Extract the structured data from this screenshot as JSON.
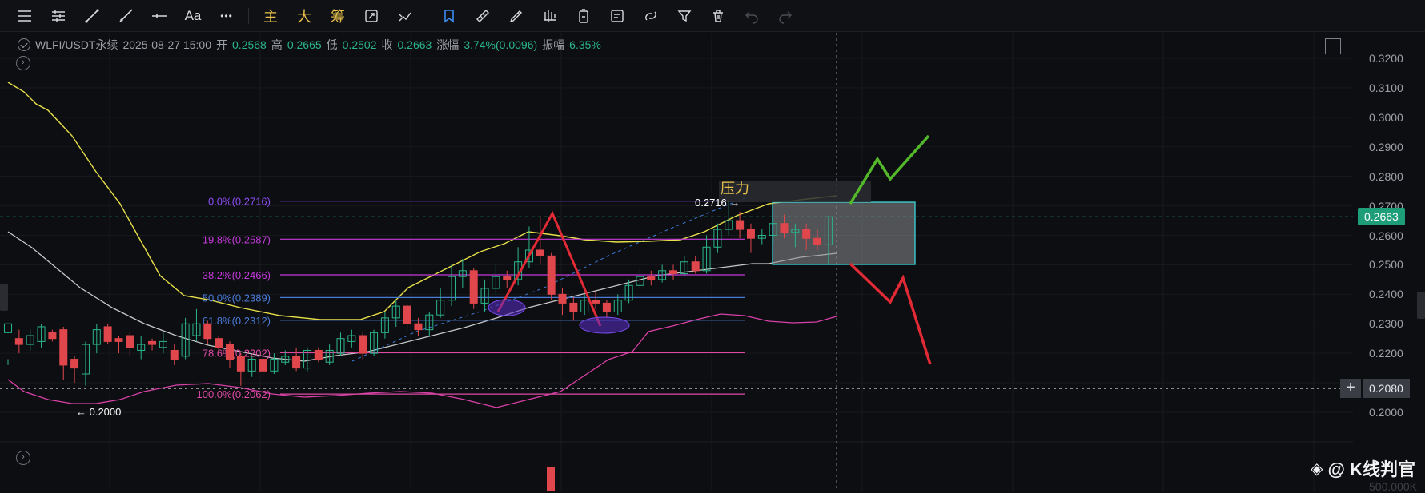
{
  "toolbar": {
    "tools": [
      {
        "name": "menu-lines-icon"
      },
      {
        "name": "horizontal-ray-icon"
      },
      {
        "name": "trend-line-icon"
      },
      {
        "name": "ray-line-icon"
      },
      {
        "name": "horizontal-line-icon"
      }
    ],
    "text_label": "Aa",
    "more_label": "•••",
    "indicators": [
      "主",
      "大",
      "筹"
    ],
    "right_tools": [
      "magnet-icon",
      "ruler-icon",
      "brush-icon",
      "pattern-icon",
      "battery-icon",
      "note-icon",
      "link-icon",
      "filter-icon",
      "trash-icon",
      "undo-icon",
      "redo-icon"
    ]
  },
  "header": {
    "symbol": "WLFI/USDT永续",
    "datetime": "2025-08-27 15:00",
    "open_label": "开",
    "open": "0.2568",
    "high_label": "高",
    "high": "0.2665",
    "low_label": "低",
    "low": "0.2502",
    "close_label": "收",
    "close": "0.2663",
    "change_label": "涨幅",
    "change": "3.74%(0.0096)",
    "amp_label": "振幅",
    "amp": "6.35%"
  },
  "price_axis": {
    "ticks": [
      "0.3200",
      "0.3100",
      "0.3000",
      "0.2900",
      "0.2800",
      "0.2700",
      "0.2600",
      "0.2500",
      "0.2400",
      "0.2300",
      "0.2200",
      "0.2100",
      "0.2000"
    ],
    "last_price": "0.2663",
    "crosshair_price": "0.2080",
    "bottom_partial": "500.000K"
  },
  "annotations": {
    "pressure_label": "压力",
    "high_mark": "0.2716",
    "low_mark": "0.2000"
  },
  "fib_levels": [
    {
      "label": "0.0%(0.2716)",
      "price": 0.2716,
      "color": "#8a4cf0"
    },
    {
      "label": "19.8%(0.2587)",
      "price": 0.2587,
      "color": "#c23ad9"
    },
    {
      "label": "38.2%(0.2466)",
      "price": 0.2466,
      "color": "#c23ad9"
    },
    {
      "label": "50.0%(0.2389)",
      "price": 0.2389,
      "color": "#4a7bd8"
    },
    {
      "label": "61.8%(0.2312)",
      "price": 0.2312,
      "color": "#4a7bd8"
    },
    {
      "label": "78.6%(0.2202)",
      "price": 0.2202,
      "color": "#e04aa6"
    },
    {
      "label": "100.0%(0.2062)",
      "price": 0.2062,
      "color": "#e04aa6"
    }
  ],
  "watermark": "@ K线判官",
  "colors": {
    "up": "#2bb58a",
    "down": "#e0474c",
    "ma_fast": "#e8e04a",
    "ma_slow": "#c8c8c8",
    "band": "#d940a8",
    "arrow_up": "#53b82a",
    "arrow_down": "#e02a35"
  }
}
